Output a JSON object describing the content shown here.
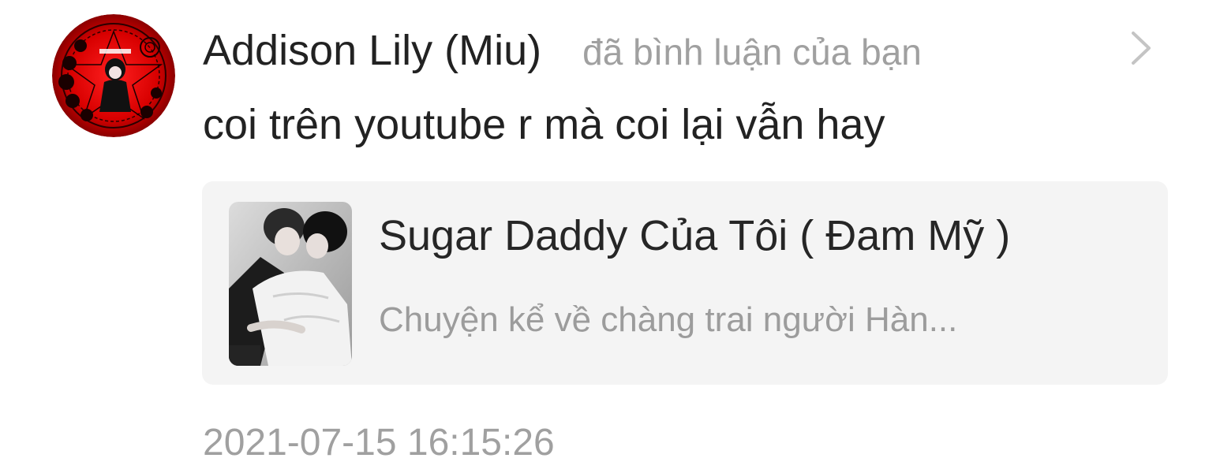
{
  "notification": {
    "user_name": "Addison Lily (Miu)",
    "action_text": "đã bình luận của bạn",
    "comment": "coi trên youtube r mà coi lại vẫn hay",
    "story": {
      "title": "Sugar Daddy Của Tôi ( Đam Mỹ )",
      "description": "Chuyện kể về chàng trai người Hàn..."
    },
    "timestamp": "2021-07-15 16:15:26"
  },
  "icons": {
    "chevron": "chevron-right-icon",
    "avatar": "user-avatar",
    "cover": "story-cover-image"
  },
  "colors": {
    "primary_text": "#222222",
    "secondary_text": "#a0a0a0",
    "card_background": "#f4f4f4",
    "avatar_red": "#d40000"
  }
}
